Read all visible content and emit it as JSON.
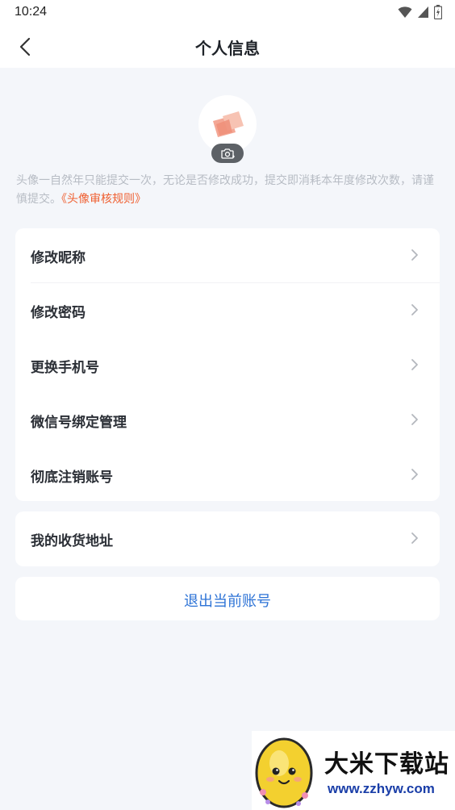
{
  "status_bar": {
    "time": "10:24",
    "icons": [
      "wifi-icon",
      "cellular-signal-icon",
      "battery-icon"
    ]
  },
  "header": {
    "title": "个人信息",
    "back_icon": "chevron-left-icon"
  },
  "avatar": {
    "camera_icon": "camera-add-icon"
  },
  "notice": {
    "text": "头像一自然年只能提交一次，无论是否修改成功，提交即消耗本年度修改次数，请谨慎提交。",
    "link": "《头像审核规则》",
    "link_color": "#ef5f30"
  },
  "settings": {
    "items": [
      {
        "label": "修改昵称"
      },
      {
        "label": "修改密码"
      },
      {
        "label": "更换手机号"
      },
      {
        "label": "微信号绑定管理"
      },
      {
        "label": "彻底注销账号"
      }
    ]
  },
  "address": {
    "label": "我的收货地址"
  },
  "logout": {
    "label": "退出当前账号",
    "color": "#2d73d6"
  },
  "watermark": {
    "name": "大米下载站",
    "url": "www.zzhyw.com"
  }
}
